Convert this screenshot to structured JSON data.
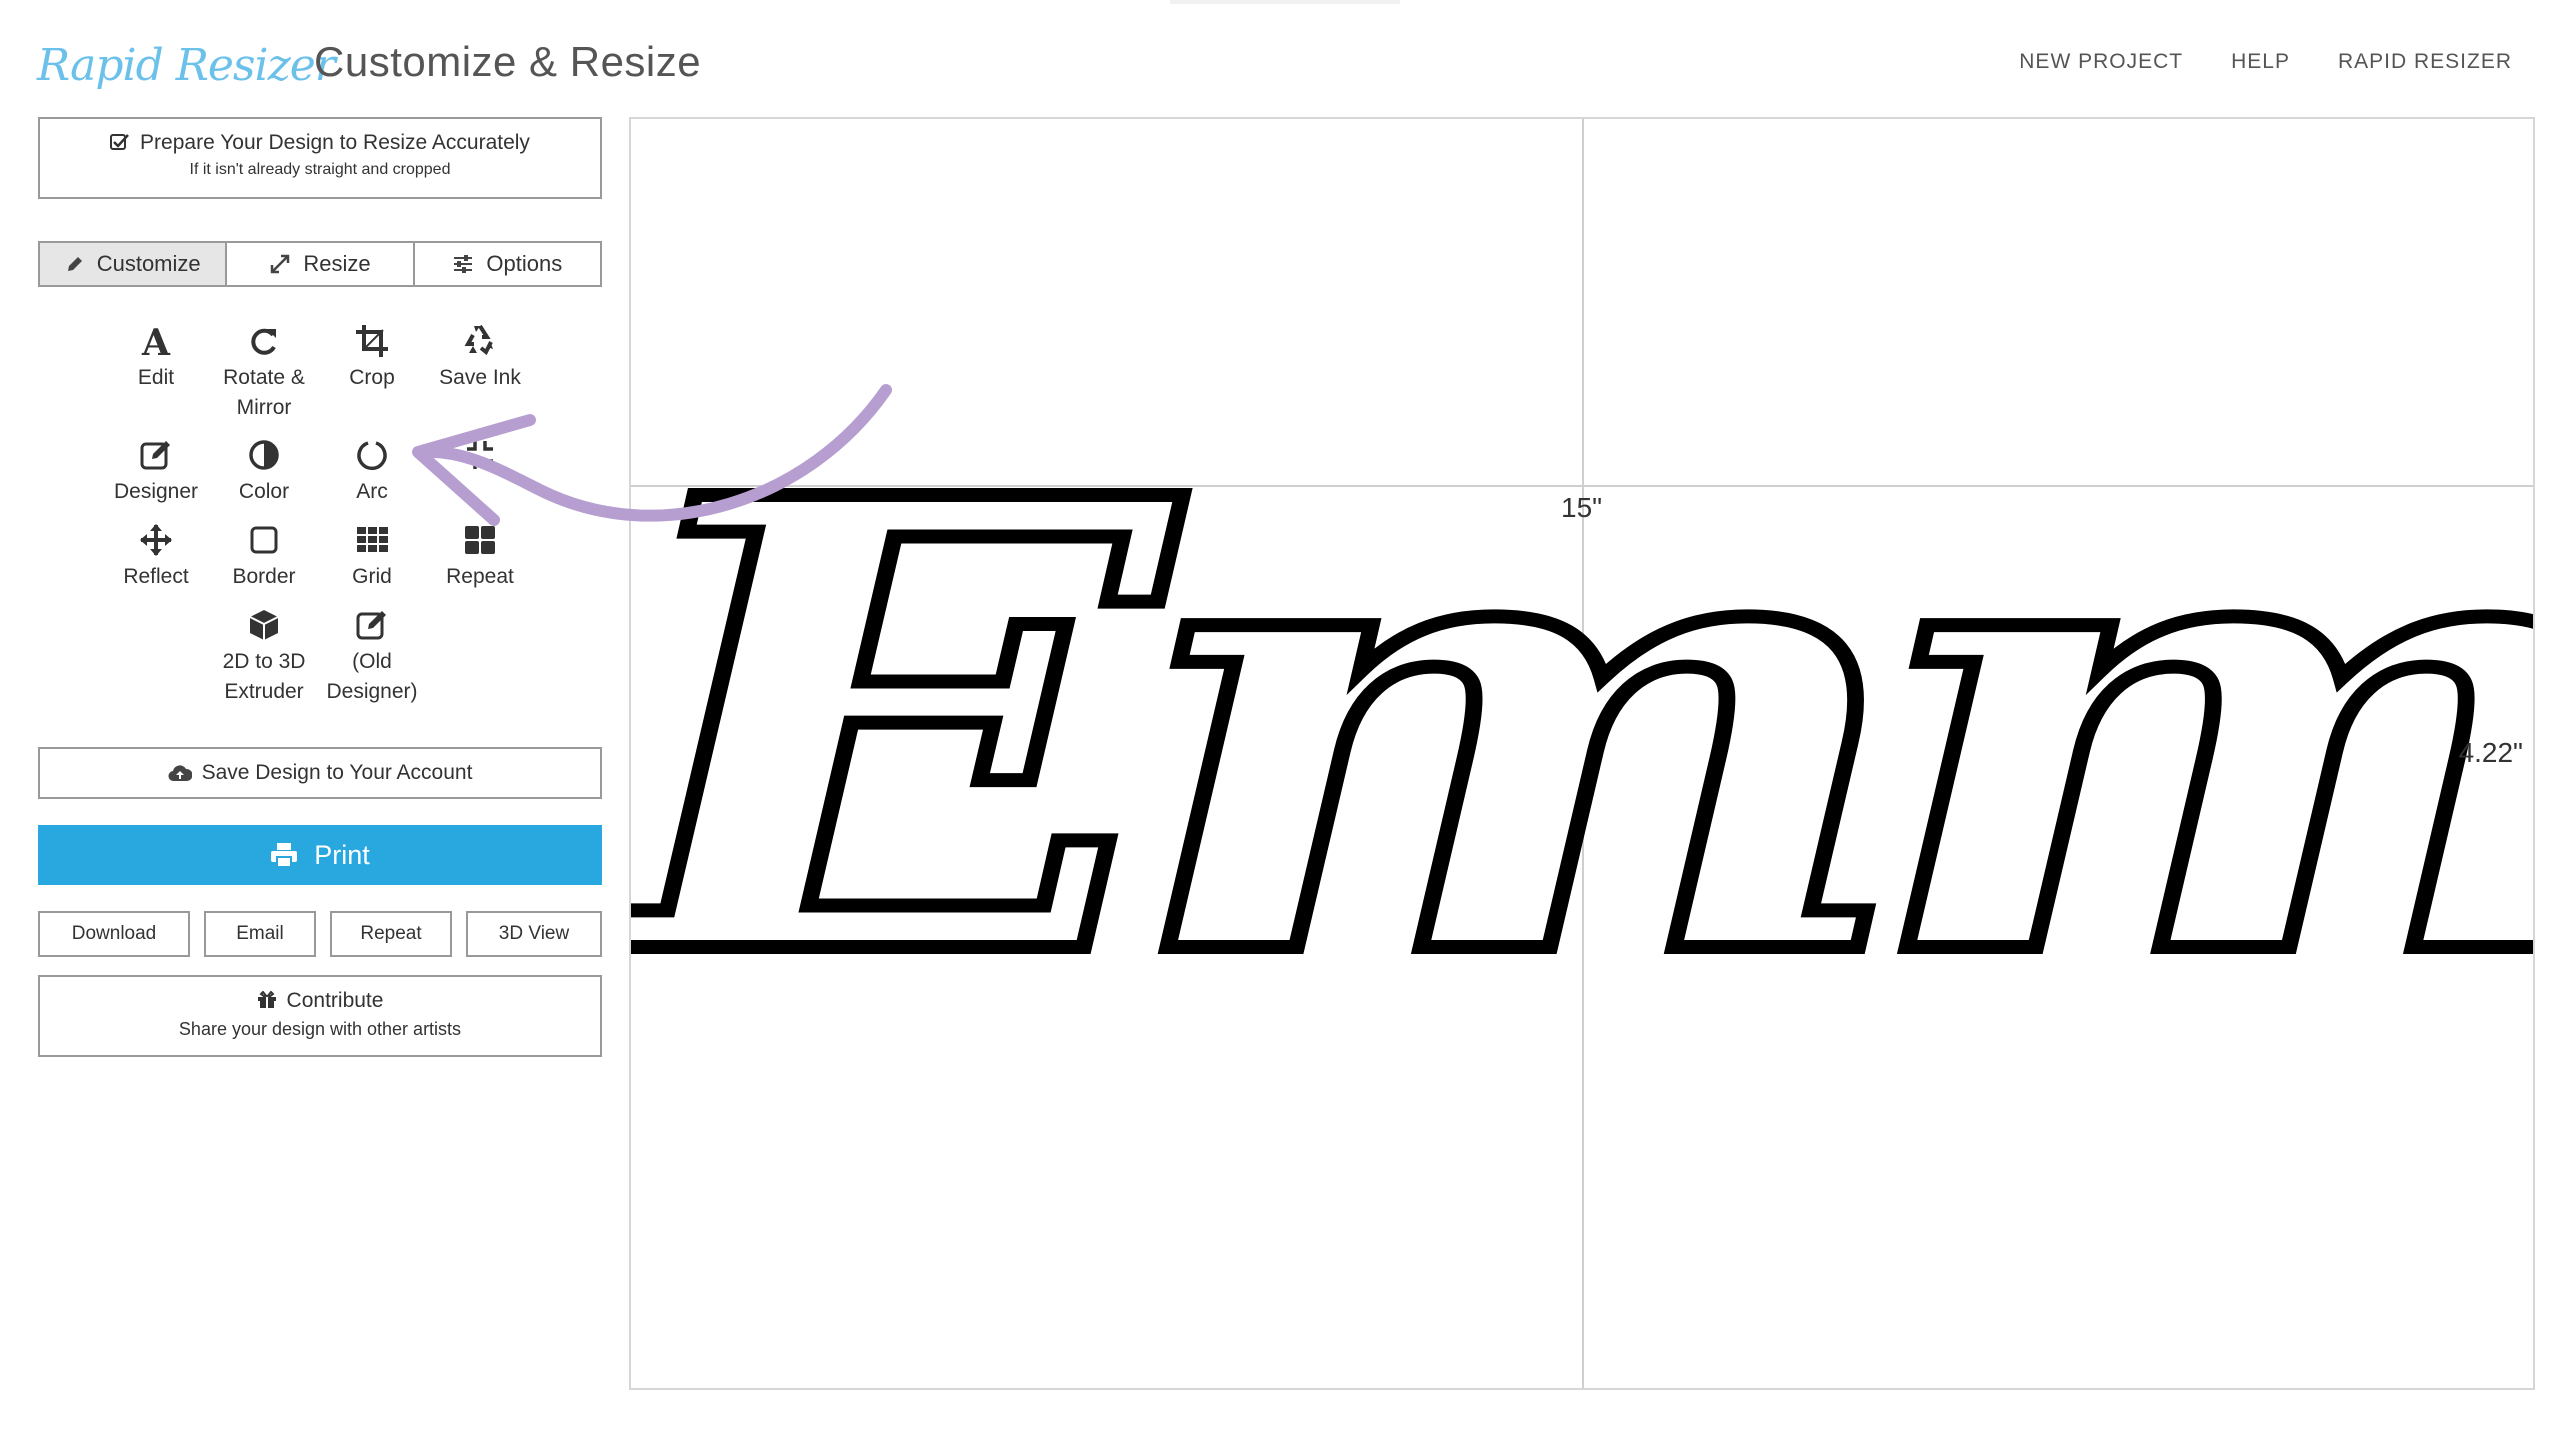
{
  "header": {
    "logo_text": "Rapid Resizer",
    "app_title": "Customize & Resize",
    "nav": [
      "NEW PROJECT",
      "HELP",
      "RAPID RESIZER"
    ]
  },
  "panel": {
    "prepare": {
      "line1": "Prepare Your Design to Resize Accurately",
      "line2": "If it isn't already straight and cropped"
    },
    "tabs": [
      {
        "label": "Customize",
        "icon": "pencil-icon",
        "active": true
      },
      {
        "label": "Resize",
        "icon": "expand-arrows-icon",
        "active": false
      },
      {
        "label": "Options",
        "icon": "sliders-icon",
        "active": false
      }
    ],
    "tools": {
      "edit": "Edit",
      "rotate": "Rotate &",
      "rotate_2": "Mirror",
      "crop": "Crop",
      "save_ink": "Save Ink",
      "designer": "Designer",
      "color": "Color",
      "arc": "Arc",
      "reflect": "Reflect",
      "border": "Border",
      "grid": "Grid",
      "repeat": "Repeat",
      "extruder": "2D to 3D",
      "extruder_2": "Extruder",
      "old_designer": "(Old",
      "old_designer_2": "Designer)"
    },
    "save_account": "Save Design to Your Account",
    "print": "Print",
    "buttons": {
      "download": "Download",
      "email": "Email",
      "repeat": "Repeat",
      "view3d": "3D View"
    },
    "contribute": {
      "line1": "Contribute",
      "line2": "Share your design with other artists"
    }
  },
  "canvas": {
    "width_label": "15\"",
    "height_label": "4.22\"",
    "design_text": "Emma"
  },
  "colors": {
    "accent": "#29a8e0",
    "logo": "#6cc1ea",
    "annotation_arrow": "#b69fd0"
  }
}
